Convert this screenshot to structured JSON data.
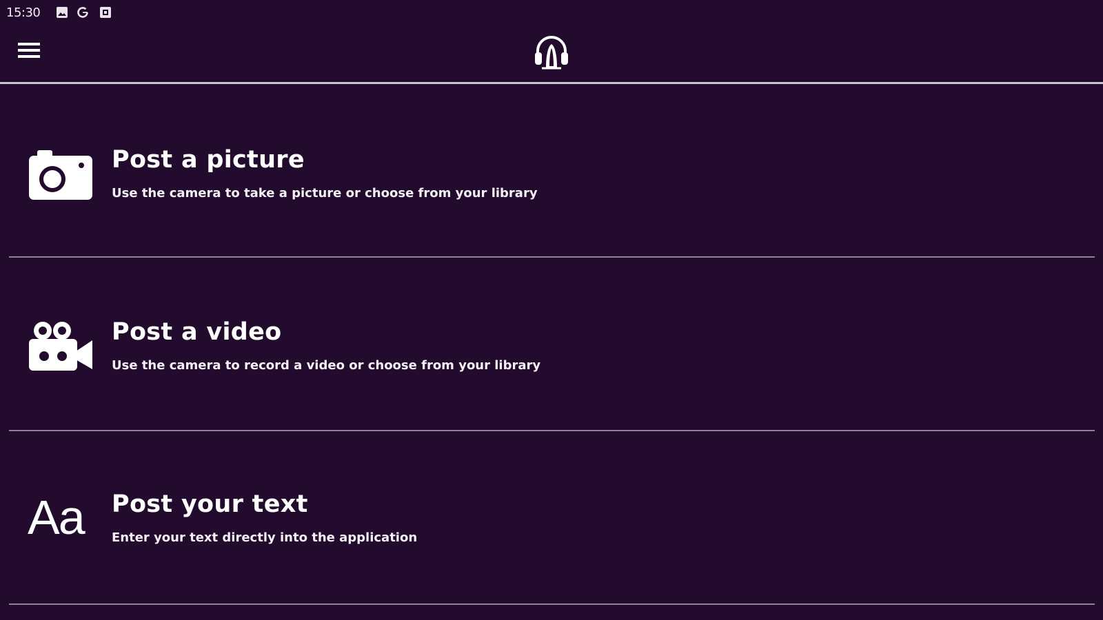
{
  "status_bar": {
    "time": "15:30",
    "icons": [
      "image-icon",
      "google-icon",
      "notification-box-icon"
    ]
  },
  "top_bar": {
    "menu_icon": "hamburger-menu-icon",
    "logo_icon": "headphones-logo-icon"
  },
  "posts": [
    {
      "icon": "camera-icon",
      "title": "Post a picture",
      "subtitle": "Use the camera to take a picture or choose from your library"
    },
    {
      "icon": "video-camera-icon",
      "title": "Post a video",
      "subtitle": "Use the camera to record a video or choose from your library"
    },
    {
      "icon": "text-aa-icon",
      "icon_text": "Aa",
      "title": "Post your text",
      "subtitle": "Enter your text directly into the application"
    }
  ],
  "colors": {
    "background": "#230b2d",
    "text": "#ffffff",
    "divider": "#8e8296",
    "header_divider": "#c9c3cc"
  }
}
